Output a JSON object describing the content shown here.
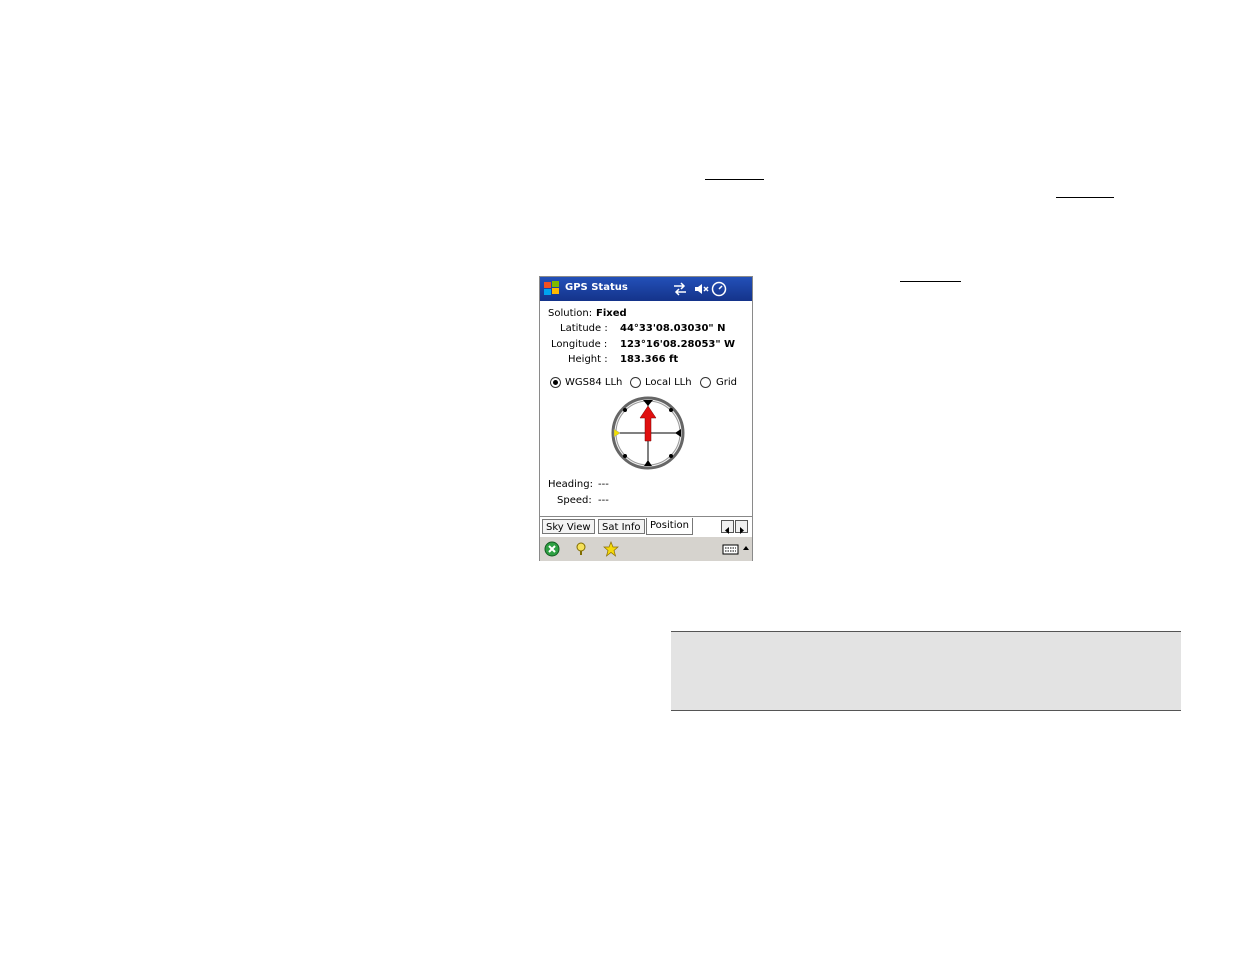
{
  "window": {
    "title": "GPS Status",
    "icons": [
      "connectivity-icon",
      "speaker-muted-icon",
      "clock-icon"
    ]
  },
  "position": {
    "solution_label": "Solution:",
    "solution_value": "Fixed",
    "latitude_label": "Latitude :",
    "latitude_value": "44°33'08.03030\" N",
    "longitude_label": "Longitude :",
    "longitude_value": "123°16'08.28053\" W",
    "height_label": "Height :",
    "height_value": "183.366 ft"
  },
  "coordinate_system": {
    "options": [
      "WGS84 LLh",
      "Local LLh",
      "Grid"
    ],
    "selected": "WGS84 LLh"
  },
  "motion": {
    "heading_label": "Heading:",
    "heading_value": "---",
    "speed_label": "Speed:",
    "speed_value": "---"
  },
  "tabs": {
    "items": [
      "Sky View",
      "Sat Info",
      "Position"
    ],
    "active": "Position"
  },
  "toolbar": {
    "icons": [
      "close-icon",
      "help-icon",
      "favorites-icon",
      "keyboard-icon"
    ]
  },
  "colors": {
    "titlebar": "#1b3fa0",
    "arrow": "#e01010",
    "toolbar": "#d6d3ce",
    "note_box": "#e3e3e3"
  }
}
